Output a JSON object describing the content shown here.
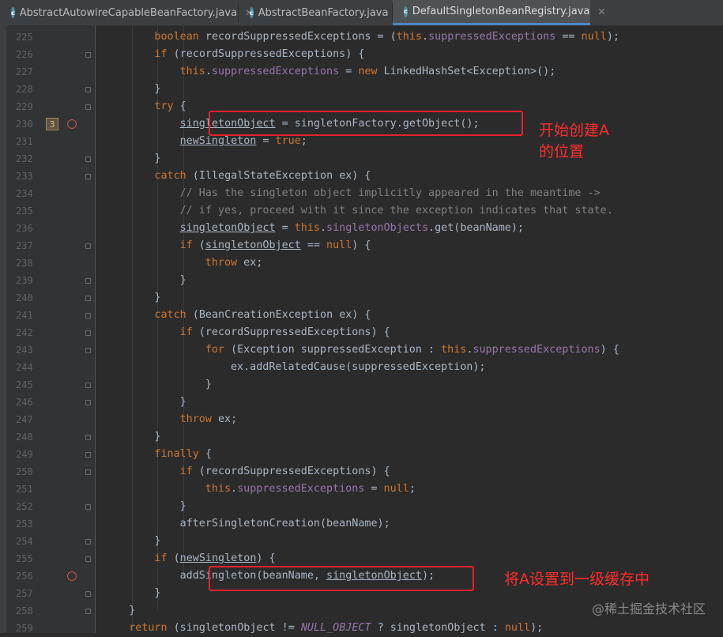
{
  "tabs": [
    {
      "label": "AbstractAutowireCapableBeanFactory.java",
      "icon": "java-class-icon",
      "close": "✕",
      "active": false
    },
    {
      "label": "AbstractBeanFactory.java",
      "icon": "java-class-icon",
      "close": "✕",
      "active": false
    },
    {
      "label": "DefaultSingletonBeanRegistry.java",
      "icon": "java-class-icon",
      "close": "✕",
      "active": true
    }
  ],
  "gutter": {
    "line_numbers": [
      "225",
      "226",
      "227",
      "228",
      "229",
      "230",
      "231",
      "232",
      "233",
      "234",
      "235",
      "236",
      "237",
      "238",
      "239",
      "240",
      "241",
      "242",
      "243",
      "244",
      "245",
      "246",
      "247",
      "248",
      "249",
      "250",
      "251",
      "252",
      "253",
      "254",
      "255",
      "256",
      "257",
      "258",
      "259"
    ],
    "breakpoint_hit_count": "3"
  },
  "code_lines": [
    [
      {
        "t": "boolean ",
        "c": "kw"
      },
      {
        "t": "recordSuppressedExceptions = ("
      },
      {
        "t": "this",
        "c": "kw"
      },
      {
        "t": "."
      },
      {
        "t": "suppressedExceptions",
        "c": "fld"
      },
      {
        "t": " == "
      },
      {
        "t": "null",
        "c": "kw"
      },
      {
        "t": ");"
      }
    ],
    [
      {
        "t": "if ",
        "c": "kw"
      },
      {
        "t": "(recordSuppressedExceptions) {"
      }
    ],
    [
      {
        "t": "this",
        "c": "kw"
      },
      {
        "t": "."
      },
      {
        "t": "suppressedExceptions",
        "c": "fld"
      },
      {
        "t": " = "
      },
      {
        "t": "new ",
        "c": "kw"
      },
      {
        "t": "LinkedHashSet<Exception>();"
      }
    ],
    [
      {
        "t": "}"
      }
    ],
    [
      {
        "t": "try ",
        "c": "kw"
      },
      {
        "t": "{"
      }
    ],
    [
      {
        "t": "singletonObject",
        "c": "ul"
      },
      {
        "t": " = singletonFactory.getObject();"
      }
    ],
    [
      {
        "t": "newSingleton",
        "c": "ul"
      },
      {
        "t": " = "
      },
      {
        "t": "true",
        "c": "kw"
      },
      {
        "t": ";"
      }
    ],
    [
      {
        "t": "}"
      }
    ],
    [
      {
        "t": "catch ",
        "c": "kw"
      },
      {
        "t": "(IllegalStateException ex) {"
      }
    ],
    [
      {
        "t": "// Has the singleton object implicitly appeared in the meantime ->",
        "c": "cmt"
      }
    ],
    [
      {
        "t": "// if yes, proceed with it since the exception indicates that state.",
        "c": "cmt"
      }
    ],
    [
      {
        "t": "singletonObject",
        "c": "ul"
      },
      {
        "t": " = "
      },
      {
        "t": "this",
        "c": "kw"
      },
      {
        "t": "."
      },
      {
        "t": "singletonObjects",
        "c": "fld"
      },
      {
        "t": ".get(beanName);"
      }
    ],
    [
      {
        "t": "if ",
        "c": "kw"
      },
      {
        "t": "("
      },
      {
        "t": "singletonObject",
        "c": "ul"
      },
      {
        "t": " == "
      },
      {
        "t": "null",
        "c": "kw"
      },
      {
        "t": ") {"
      }
    ],
    [
      {
        "t": "throw ",
        "c": "kw"
      },
      {
        "t": "ex;"
      }
    ],
    [
      {
        "t": "}"
      }
    ],
    [
      {
        "t": "}"
      }
    ],
    [
      {
        "t": "catch ",
        "c": "kw"
      },
      {
        "t": "(BeanCreationException ex) {"
      }
    ],
    [
      {
        "t": "if ",
        "c": "kw"
      },
      {
        "t": "(recordSuppressedExceptions) {"
      }
    ],
    [
      {
        "t": "for ",
        "c": "kw"
      },
      {
        "t": "(Exception suppressedException : "
      },
      {
        "t": "this",
        "c": "kw"
      },
      {
        "t": "."
      },
      {
        "t": "suppressedExceptions",
        "c": "fld"
      },
      {
        "t": ") {"
      }
    ],
    [
      {
        "t": "ex.addRelatedCause(suppressedException);"
      }
    ],
    [
      {
        "t": "}"
      }
    ],
    [
      {
        "t": "}"
      }
    ],
    [
      {
        "t": "throw ",
        "c": "kw"
      },
      {
        "t": "ex;"
      }
    ],
    [
      {
        "t": "}"
      }
    ],
    [
      {
        "t": "finally ",
        "c": "kw"
      },
      {
        "t": "{"
      }
    ],
    [
      {
        "t": "if ",
        "c": "kw"
      },
      {
        "t": "(recordSuppressedExceptions) {"
      }
    ],
    [
      {
        "t": "this",
        "c": "kw"
      },
      {
        "t": "."
      },
      {
        "t": "suppressedExceptions",
        "c": "fld"
      },
      {
        "t": " = "
      },
      {
        "t": "null",
        "c": "kw"
      },
      {
        "t": ";"
      }
    ],
    [
      {
        "t": "}"
      }
    ],
    [
      {
        "t": "afterSingletonCreation(beanName);"
      }
    ],
    [
      {
        "t": "}"
      }
    ],
    [
      {
        "t": "if ",
        "c": "kw"
      },
      {
        "t": "("
      },
      {
        "t": "newSingleton",
        "c": "ul"
      },
      {
        "t": ") {"
      }
    ],
    [
      {
        "t": "addSingleton(beanName, "
      },
      {
        "t": "singletonObject",
        "c": "ul"
      },
      {
        "t": ");"
      }
    ],
    [
      {
        "t": "}"
      }
    ],
    [
      {
        "t": "}"
      }
    ],
    [
      {
        "t": "return ",
        "c": "kw"
      },
      {
        "t": "(singletonObject != "
      },
      {
        "t": "NULL_OBJECT",
        "c": "it"
      },
      {
        "t": " ? singletonObject : "
      },
      {
        "t": "null",
        "c": "kw"
      },
      {
        "t": ");"
      }
    ]
  ],
  "annotations": {
    "create_a_line1": "开始创建A",
    "create_a_line2": "的位置",
    "add_singleton": "将A设置到一级缓存中"
  },
  "watermark": "@稀土掘金技术社区",
  "colors": {
    "keyword": "#cc7832",
    "field": "#9876aa",
    "default": "#a9b7c6",
    "comment": "#808080",
    "annotation": "#ff2d2d",
    "highlight_box": "#e8202a"
  }
}
